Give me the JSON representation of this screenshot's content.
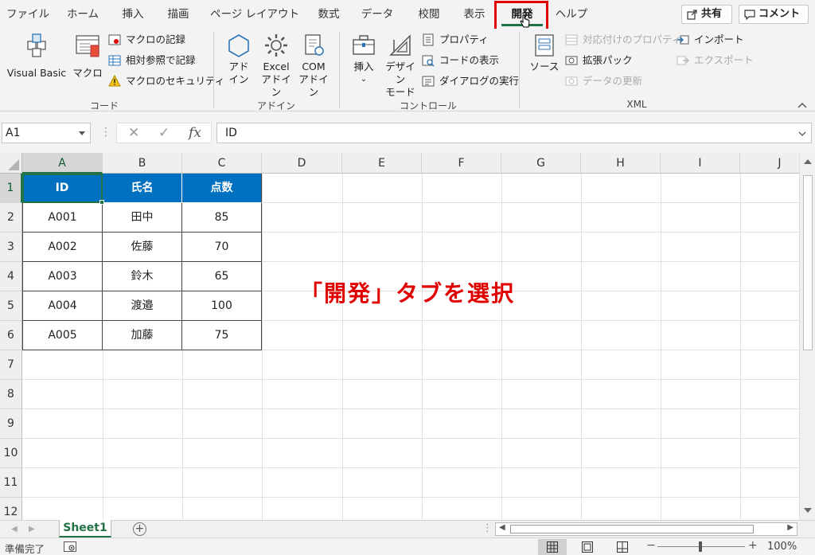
{
  "tabs": [
    {
      "label": "ファイル"
    },
    {
      "label": "ホーム"
    },
    {
      "label": "挿入"
    },
    {
      "label": "描画"
    },
    {
      "label": "ページ レイアウト"
    },
    {
      "label": "数式"
    },
    {
      "label": "データ"
    },
    {
      "label": "校閲"
    },
    {
      "label": "表示"
    },
    {
      "label": "開発"
    },
    {
      "label": "ヘルプ"
    }
  ],
  "active_tab": "開発",
  "top_buttons": {
    "share": "共有",
    "comment": "コメント"
  },
  "ribbon": {
    "code": {
      "label": "コード",
      "visual_basic": "Visual Basic",
      "macro": "マクロ",
      "record_macro": "マクロの記録",
      "relative_ref": "相対参照で記録",
      "macro_security": "マクロのセキュリティ"
    },
    "addins": {
      "label": "アドイン",
      "addin_1": "アド",
      "addin_2": "イン",
      "excel_addin_1": "Excel",
      "excel_addin_2": "アドイン",
      "com_addin_1": "COM",
      "com_addin_2": "アドイン"
    },
    "controls": {
      "label": "コントロール",
      "insert": "挿入",
      "design_1": "デザイン",
      "design_2": "モード",
      "properties": "プロパティ",
      "view_code": "コードの表示",
      "run_dialog": "ダイアログの実行"
    },
    "xml": {
      "label": "XML",
      "source": "ソース",
      "map_properties": "対応付けのプロパティ",
      "expansion_packs": "拡張パック",
      "refresh_data": "データの更新",
      "import": "インポート",
      "export": "エクスポート"
    }
  },
  "formula_bar": {
    "name_box": "A1",
    "cancel": "✕",
    "enter": "✓",
    "fx": "fx",
    "value": "ID"
  },
  "columns": [
    "A",
    "B",
    "C",
    "D",
    "E",
    "F",
    "G",
    "H",
    "I",
    "J"
  ],
  "rows": [
    "1",
    "2",
    "3",
    "4",
    "5",
    "6",
    "7",
    "8",
    "9",
    "10",
    "11",
    "12"
  ],
  "table": {
    "headers": [
      "ID",
      "氏名",
      "点数"
    ],
    "rows": [
      [
        "A001",
        "田中",
        "85"
      ],
      [
        "A002",
        "佐藤",
        "70"
      ],
      [
        "A003",
        "鈴木",
        "65"
      ],
      [
        "A004",
        "渡邉",
        "100"
      ],
      [
        "A005",
        "加藤",
        "75"
      ]
    ]
  },
  "annotation": "「開発」タブを選択",
  "sheet_tab": "Sheet1",
  "add_sheet": "+",
  "status": {
    "text": "準備完了",
    "zoom": "100%",
    "zoom_minus": "−",
    "zoom_plus": "+"
  },
  "colors": {
    "accent": "#217346",
    "header_fill": "#0070c0",
    "annotation": "#e00000"
  },
  "icons": [
    "cursor-icon",
    "share-icon",
    "comment-icon",
    "visual-basic-icon",
    "macro-icon",
    "addin-icon",
    "gear-icon",
    "com-addin-icon",
    "toolbox-icon",
    "design-mode-icon",
    "source-icon",
    "normal-view-icon",
    "page-layout-icon",
    "page-break-icon"
  ]
}
